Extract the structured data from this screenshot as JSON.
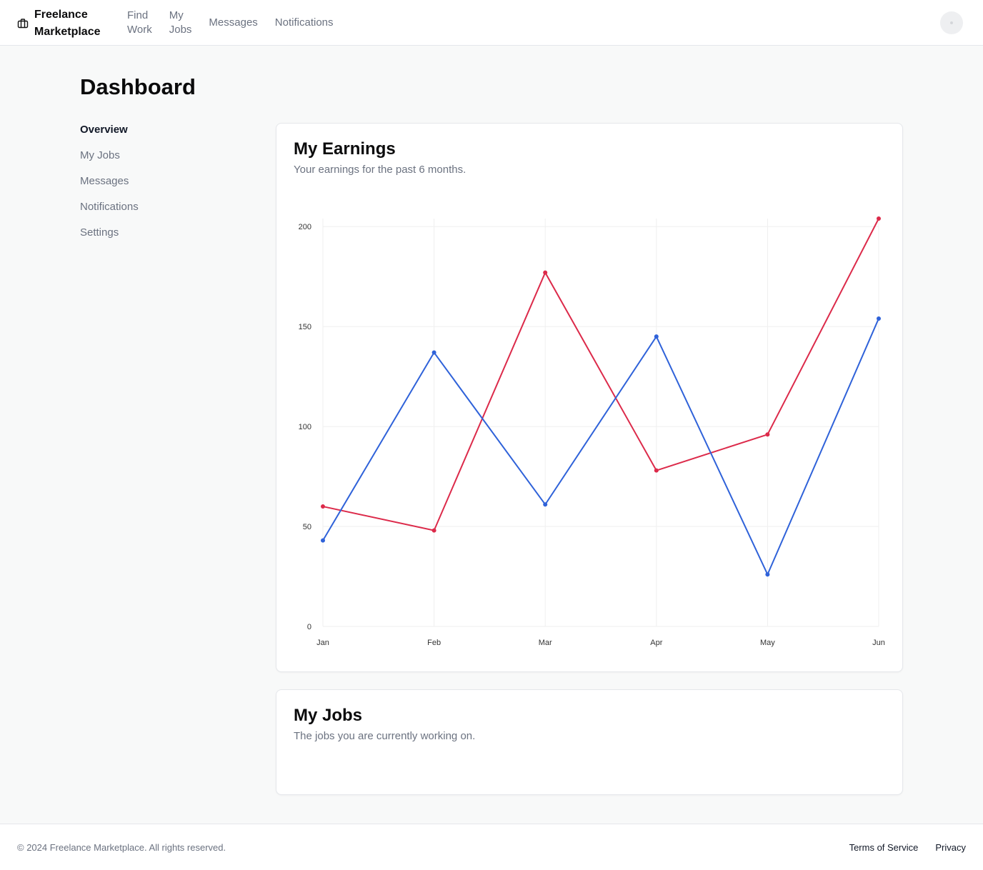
{
  "header": {
    "brand": "Freelance Marketplace",
    "nav": [
      {
        "label_line1": "Find",
        "label_line2": "Work"
      },
      {
        "label_line1": "My",
        "label_line2": "Jobs"
      },
      {
        "label": "Messages"
      },
      {
        "label": "Notifications"
      }
    ]
  },
  "page": {
    "title": "Dashboard"
  },
  "sidebar": {
    "items": [
      {
        "label": "Overview",
        "active": true
      },
      {
        "label": "My Jobs"
      },
      {
        "label": "Messages"
      },
      {
        "label": "Notifications"
      },
      {
        "label": "Settings"
      }
    ]
  },
  "earnings_card": {
    "title": "My Earnings",
    "subtitle": "Your earnings for the past 6 months."
  },
  "jobs_card": {
    "title": "My Jobs",
    "subtitle": "The jobs you are currently working on."
  },
  "chart_data": {
    "type": "line",
    "categories": [
      "Jan",
      "Feb",
      "Mar",
      "Apr",
      "May",
      "Jun"
    ],
    "yticks": [
      0,
      50,
      100,
      150,
      200
    ],
    "ylim": [
      0,
      204
    ],
    "grid": true,
    "series": [
      {
        "color": "#dc2a4a",
        "values": [
          60,
          48,
          177,
          78,
          96,
          204
        ]
      },
      {
        "color": "#2f62d9",
        "values": [
          43,
          137,
          61,
          145,
          26,
          154
        ]
      }
    ]
  },
  "footer": {
    "copyright": "© 2024 Freelance Marketplace. All rights reserved.",
    "links": [
      "Terms of Service",
      "Privacy"
    ]
  },
  "icons": {
    "brand": "briefcase-icon",
    "avatar": "avatar-icon"
  }
}
